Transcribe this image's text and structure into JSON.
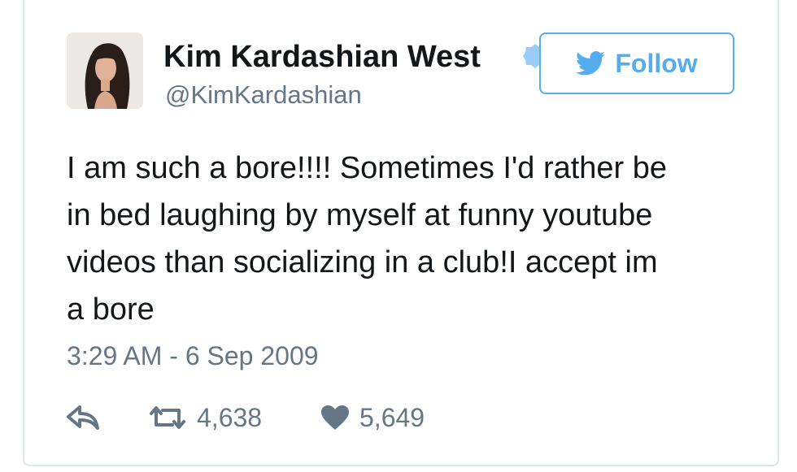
{
  "author": {
    "display_name": "Kim Kardashian West",
    "handle": "@KimKardashian",
    "verified_icon": "verified-badge-icon"
  },
  "follow_button": {
    "label": "Follow",
    "icon": "twitter-bird-icon"
  },
  "tweet": {
    "text_lines": [
      "I am such a bore!!!! Sometimes I'd rather be",
      "in bed laughing by myself at funny youtube",
      "videos than socializing in a club!I accept im",
      "a bore"
    ],
    "timestamp": "3:29 AM - 6 Sep 2009"
  },
  "actions": {
    "reply_icon": "reply-icon",
    "retweet_icon": "retweet-icon",
    "retweet_count": "4,638",
    "like_icon": "heart-icon",
    "like_count": "5,649"
  },
  "colors": {
    "accent": "#55acee",
    "text": "#14171a",
    "muted": "#657786",
    "border": "#e1e8ed"
  }
}
